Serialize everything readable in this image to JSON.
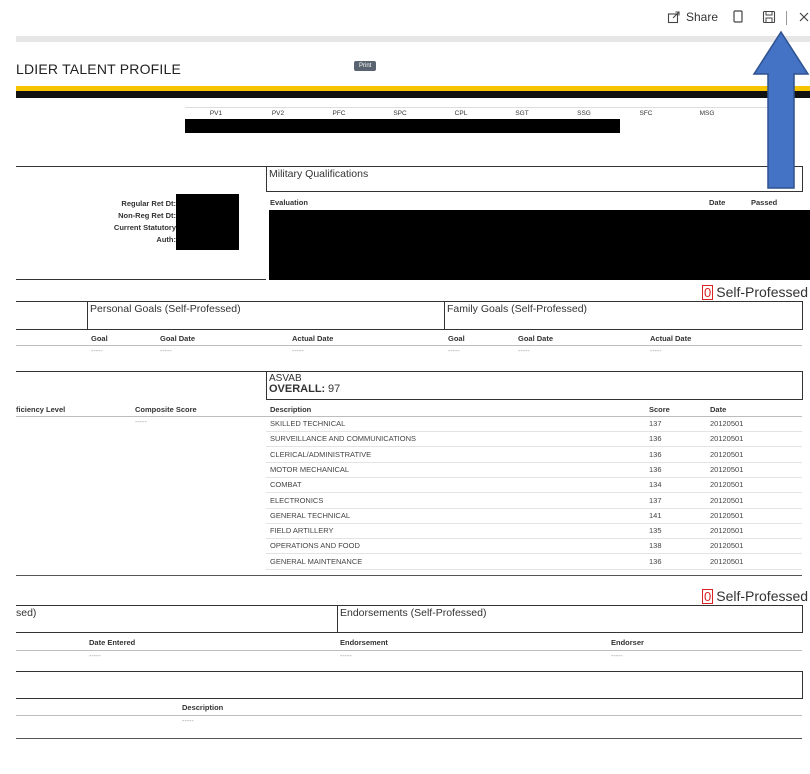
{
  "toolbar": {
    "share_label": "Share",
    "icons": [
      "share-icon",
      "copy-icon",
      "save-icon",
      "close-icon"
    ]
  },
  "header": {
    "title": "LDIER TALENT PROFILE",
    "print_label": "Print"
  },
  "ranks": [
    "PV1",
    "PV2",
    "PFC",
    "SPC",
    "CPL",
    "SGT",
    "SSG",
    "SFC",
    "MSG"
  ],
  "military_qualifications": {
    "title": "Military Qualifications",
    "left_labels": [
      "Regular Ret Dt:",
      "Non-Reg Ret Dt:",
      "Current Statutory",
      "Auth:"
    ],
    "columns": [
      "Evaluation",
      "Date",
      "Passed"
    ]
  },
  "goals": {
    "count": "0",
    "count_label": "Self-Professed",
    "personal_title": "Personal Goals (Self-Professed)",
    "family_title": "Family Goals (Self-Professed)",
    "personal_columns": [
      "Goal",
      "Goal Date",
      "Actual Date"
    ],
    "family_columns": [
      "Goal",
      "Goal Date",
      "Actual Date"
    ],
    "empty": "-----"
  },
  "asvab": {
    "title": "ASVAB",
    "overall_label": "OVERALL:",
    "overall_value": "97",
    "left_columns": [
      "ficiency Level",
      "Composite Score"
    ],
    "columns": [
      "Description",
      "Score",
      "Date"
    ],
    "empty": "-----",
    "rows": [
      {
        "description": "SKILLED TECHNICAL",
        "score": "137",
        "date": "20120501"
      },
      {
        "description": "SURVEILLANCE AND COMMUNICATIONS",
        "score": "136",
        "date": "20120501"
      },
      {
        "description": "CLERICAL/ADMINISTRATIVE",
        "score": "136",
        "date": "20120501"
      },
      {
        "description": "MOTOR MECHANICAL",
        "score": "136",
        "date": "20120501"
      },
      {
        "description": "COMBAT",
        "score": "134",
        "date": "20120501"
      },
      {
        "description": "ELECTRONICS",
        "score": "137",
        "date": "20120501"
      },
      {
        "description": "GENERAL TECHNICAL",
        "score": "141",
        "date": "20120501"
      },
      {
        "description": "FIELD ARTILLERY",
        "score": "135",
        "date": "20120501"
      },
      {
        "description": "OPERATIONS AND FOOD",
        "score": "138",
        "date": "20120501"
      },
      {
        "description": "GENERAL MAINTENANCE",
        "score": "136",
        "date": "20120501"
      }
    ]
  },
  "endorsements": {
    "count": "0",
    "count_label": "Self-Professed",
    "left_title": "sed)",
    "title": "Endorsements (Self-Professed)",
    "columns": [
      "Date Entered",
      "Endorsement",
      "Endorser"
    ],
    "empty": "-----"
  },
  "last_section": {
    "columns": [
      "Description"
    ],
    "empty": "-----"
  },
  "colors": {
    "stripe_yellow": "#f6c500",
    "stripe_black": "#111111",
    "arrow_blue": "#4472c4",
    "count_red": "#dd2222"
  }
}
